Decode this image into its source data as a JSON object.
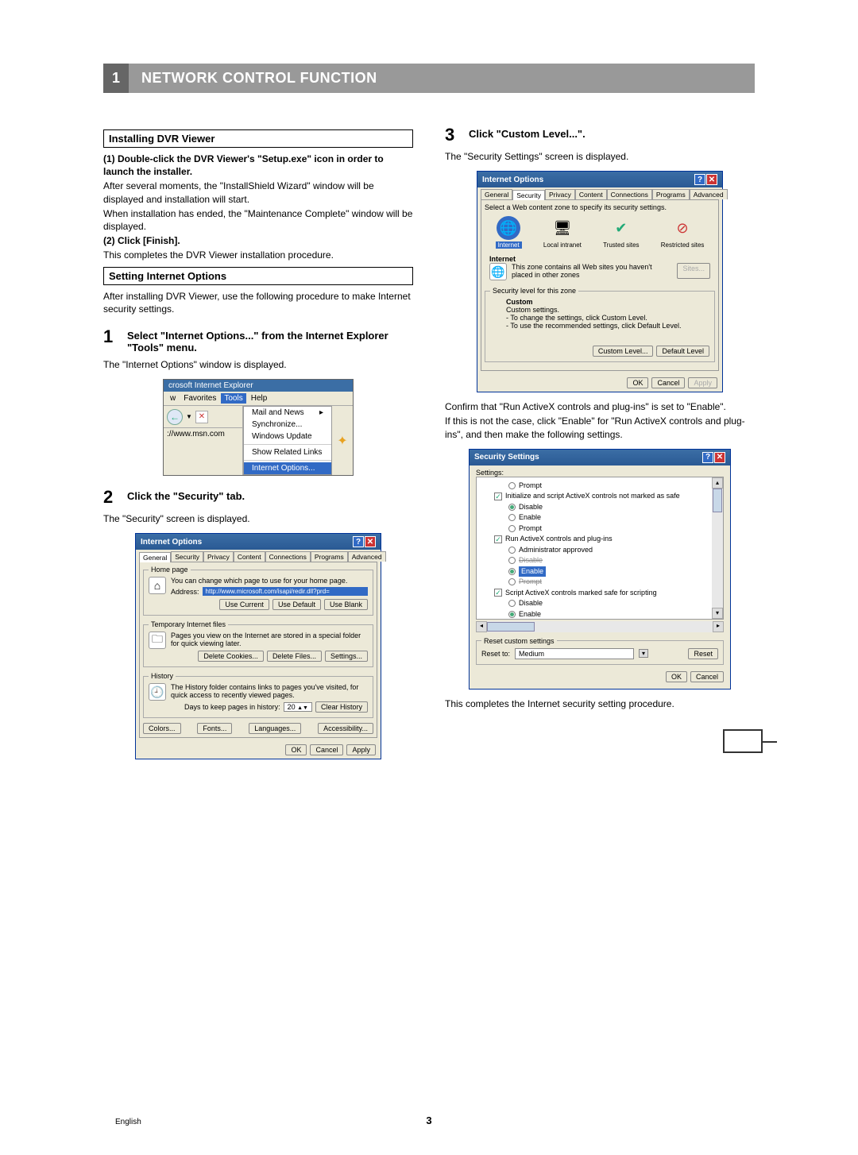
{
  "header": {
    "num": "1",
    "title": "NETWORK CONTROL FUNCTION"
  },
  "left": {
    "sec1": "Installing DVR Viewer",
    "p1": "(1) Double-click the DVR Viewer's \"Setup.exe\" icon in order to launch the installer.",
    "p2": "After several moments, the \"InstallShield Wizard\" window will be displayed and installation will start.",
    "p3": "When installation has ended, the \"Maintenance Complete\" window will be displayed.",
    "p4": "(2) Click [Finish].",
    "p5": "This completes the DVR Viewer installation procedure.",
    "sec2": "Setting Internet Options",
    "p6": "After installing DVR Viewer, use the following procedure to make Internet security settings.",
    "step1": {
      "num": "1",
      "text": "Select \"Internet Options...\" from the Internet Explorer \"Tools\" menu."
    },
    "p7": "The \"Internet Options\" window is displayed.",
    "ie": {
      "title": "crosoft Internet Explorer",
      "menu_w": "w",
      "menu_fav": "Favorites",
      "menu_tools": "Tools",
      "menu_help": "Help",
      "addr": "://www.msn.com",
      "items": {
        "mail": "Mail and News",
        "sync": "Synchronize...",
        "wu": "Windows Update",
        "srl": "Show Related Links",
        "io": "Internet Options..."
      }
    },
    "step2": {
      "num": "2",
      "text": "Click the \"Security\" tab."
    },
    "p8": "The \"Security\" screen is displayed.",
    "dlg1": {
      "title": "Internet Options",
      "tabs": [
        "General",
        "Security",
        "Privacy",
        "Content",
        "Connections",
        "Programs",
        "Advanced"
      ],
      "home_legend": "Home page",
      "home_text": "You can change which page to use for your home page.",
      "addr_lbl": "Address:",
      "addr_val": "http://www.microsoft.com/isapi/redir.dll?prd=",
      "btn_cur": "Use Current",
      "btn_def": "Use Default",
      "btn_blank": "Use Blank",
      "temp_legend": "Temporary Internet files",
      "temp_text": "Pages you view on the Internet are stored in a special folder for quick viewing later.",
      "btn_dc": "Delete Cookies...",
      "btn_df": "Delete Files...",
      "btn_set": "Settings...",
      "hist_legend": "History",
      "hist_text": "The History folder contains links to pages you've visited, for quick access to recently viewed pages.",
      "days_lbl": "Days to keep pages in history:",
      "days_val": "20",
      "btn_ch": "Clear History",
      "btn_col": "Colors...",
      "btn_fonts": "Fonts...",
      "btn_lang": "Languages...",
      "btn_acc": "Accessibility...",
      "ok": "OK",
      "cancel": "Cancel",
      "apply": "Apply"
    }
  },
  "right": {
    "step3": {
      "num": "3",
      "text": "Click \"Custom Level...\"."
    },
    "p1": "The \"Security Settings\" screen is displayed.",
    "dlg2": {
      "title": "Internet Options",
      "tabs": [
        "General",
        "Security",
        "Privacy",
        "Content",
        "Connections",
        "Programs",
        "Advanced"
      ],
      "select_text": "Select a Web content zone to specify its security settings.",
      "zones": {
        "internet": "Internet",
        "local": "Local intranet",
        "trusted": "Trusted sites",
        "restricted": "Restricted sites"
      },
      "zone_name": "Internet",
      "zone_desc": "This zone contains all Web sites you haven't placed in other zones",
      "sites": "Sites...",
      "sec_legend": "Security level for this zone",
      "custom": "Custom",
      "custom_settings": "Custom settings.",
      "custom_l1": "- To change the settings, click Custom Level.",
      "custom_l2": "- To use the recommended settings, click Default Level.",
      "btn_cl": "Custom Level...",
      "btn_dl": "Default Level",
      "ok": "OK",
      "cancel": "Cancel",
      "apply": "Apply"
    },
    "p2": "Confirm that \"Run ActiveX controls and plug-ins\" is set to \"Enable\".",
    "p3": "If this is not the case, click \"Enable\" for \"Run ActiveX controls and plug-ins\", and then make the following settings.",
    "dlg3": {
      "title": "Security Settings",
      "settings": "Settings:",
      "items": {
        "prompt1": "Prompt",
        "init": "Initialize and script ActiveX controls not marked as safe",
        "disable1": "Disable",
        "enable1": "Enable",
        "prompt2": "Prompt",
        "run": "Run ActiveX controls and plug-ins",
        "admin": "Administrator approved",
        "disable_strike": "Disable",
        "enable_hl": "Enable",
        "prompt_strike": "Prompt",
        "script": "Script ActiveX controls marked safe for scripting",
        "disable2": "Disable",
        "enable2": "Enable"
      },
      "reset_legend": "Reset custom settings",
      "reset_to": "Reset to:",
      "reset_val": "Medium",
      "btn_reset": "Reset",
      "ok": "OK",
      "cancel": "Cancel"
    },
    "p4": "This completes the Internet security setting procedure."
  },
  "footer": {
    "lang": "English",
    "page": "3"
  }
}
